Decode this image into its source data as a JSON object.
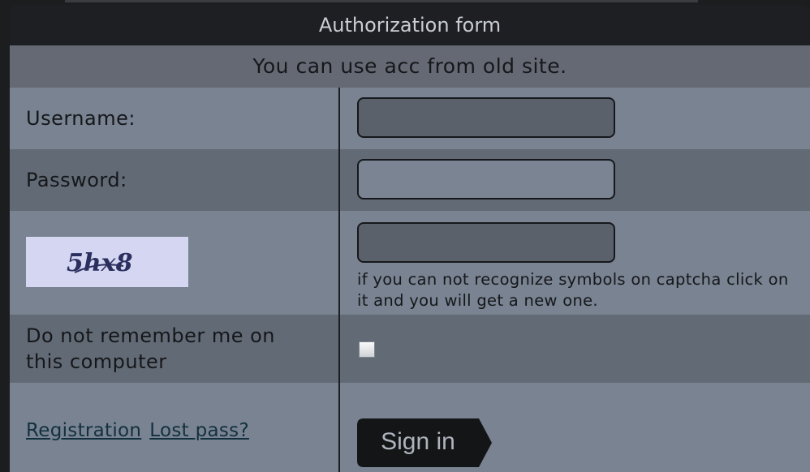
{
  "form": {
    "title": "Authorization form",
    "notice": "You can use acc from old site."
  },
  "fields": {
    "username_label": "Username:",
    "username_value": "",
    "password_label": "Password:",
    "password_value": "",
    "captcha_text": "5hx8",
    "captcha_value": "",
    "captcha_hint": "if you can not recognize symbols on captcha click on it and you will get a new one.",
    "remember_label": "Do not remember me on this computer"
  },
  "links": {
    "registration": "Registration",
    "lost_pass": "Lost pass?"
  },
  "buttons": {
    "sign_in": "Sign in"
  },
  "colors": {
    "title_bar": "#1e1f22",
    "row_light": "#798391",
    "row_dark": "#626a75",
    "link": "#13303f",
    "captcha_bg": "#d4d6f2"
  }
}
